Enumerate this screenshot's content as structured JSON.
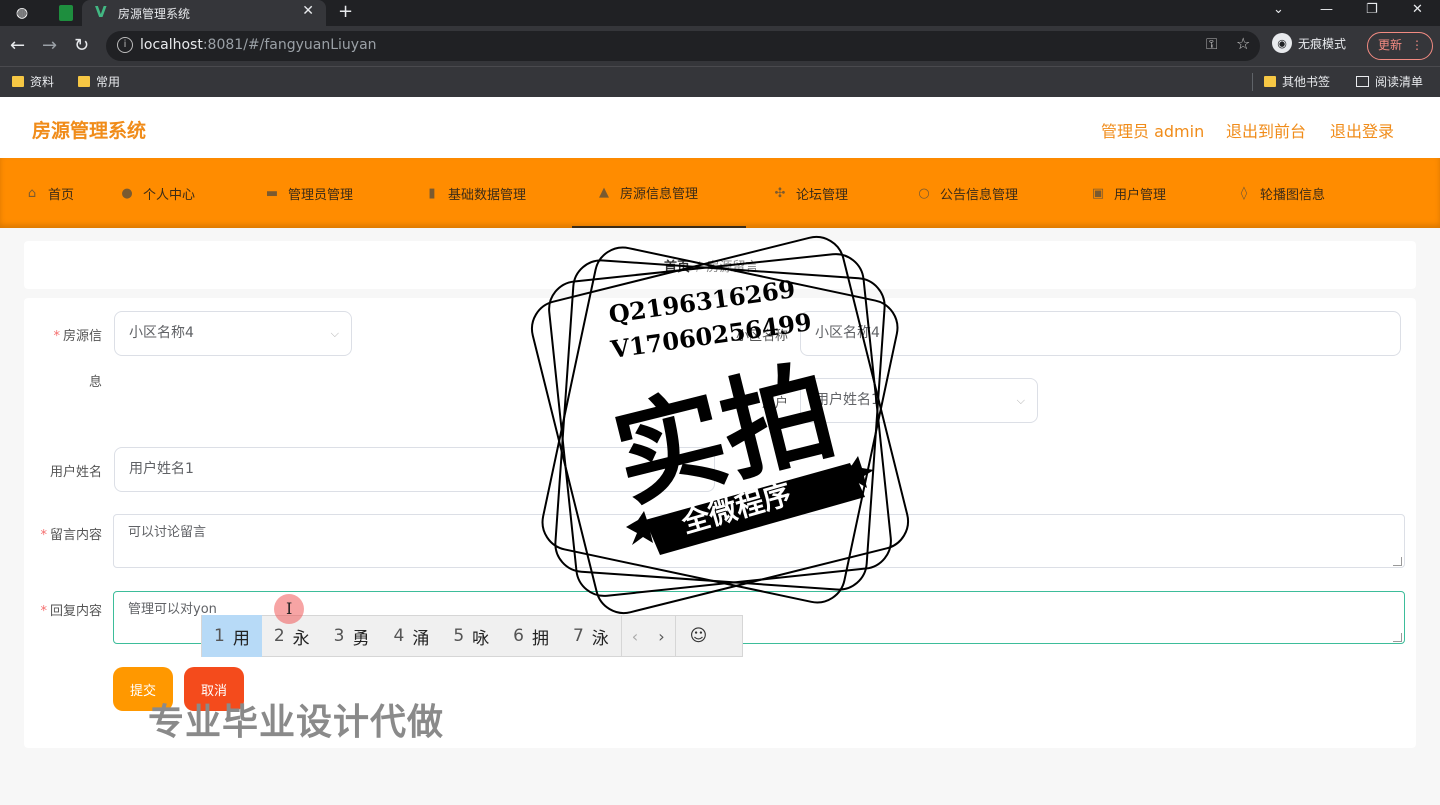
{
  "browser": {
    "tab_title": "房源管理系统",
    "url_host": "localhost",
    "url_rest": ":8081/#/fangyuanLiuyan",
    "incognito_label": "无痕模式",
    "update_label": "更新",
    "bookmarks": [
      "资料",
      "常用"
    ],
    "bookmarks_right": [
      "其他书签",
      "阅读清单"
    ]
  },
  "app": {
    "title": "房源管理系统",
    "header_links": [
      "管理员 admin",
      "退出到前台",
      "退出登录"
    ]
  },
  "nav": [
    {
      "label": "首页",
      "icon": "home-icon"
    },
    {
      "label": "个人中心",
      "icon": "user-icon"
    },
    {
      "label": "管理员管理",
      "icon": "chat-icon"
    },
    {
      "label": "基础数据管理",
      "icon": "bar-icon"
    },
    {
      "label": "房源信息管理",
      "icon": "person-icon"
    },
    {
      "label": "论坛管理",
      "icon": "forum-icon"
    },
    {
      "label": "公告信息管理",
      "icon": "circle-icon"
    },
    {
      "label": "用户管理",
      "icon": "users-icon"
    },
    {
      "label": "轮播图信息",
      "icon": "pin-icon"
    }
  ],
  "breadcrumb": {
    "home": "首页",
    "sep": "/",
    "current": "房源留言"
  },
  "form": {
    "fangyuan_label_1": "房源信",
    "fangyuan_label_2": "息",
    "fangyuan_value": "小区名称4",
    "xiaoqu_label": "小区名称",
    "xiaoqu_value": "小区名称4",
    "user_select_label": "用户",
    "user_select_value": "用户姓名1",
    "user_name_label": "用户姓名",
    "user_name_value": "用户姓名1",
    "liuyan_label": "留言内容",
    "liuyan_value": "可以讨论留言",
    "huifu_label": "回复内容",
    "huifu_value": "管理可以对yon",
    "submit_label": "提交",
    "cancel_label": "取消"
  },
  "ime": {
    "candidates": [
      {
        "num": "1",
        "char": "用"
      },
      {
        "num": "2",
        "char": "永"
      },
      {
        "num": "3",
        "char": "勇"
      },
      {
        "num": "4",
        "char": "涌"
      },
      {
        "num": "5",
        "char": "咏"
      },
      {
        "num": "6",
        "char": "拥"
      },
      {
        "num": "7",
        "char": "泳"
      }
    ],
    "prev": "‹",
    "next": "›",
    "emoji": "☺"
  },
  "watermark": {
    "qq": "Q2196316269",
    "v": "V17060256499",
    "big": "实拍",
    "banner": "全微程序",
    "bottom": "专业毕业设计代做"
  }
}
